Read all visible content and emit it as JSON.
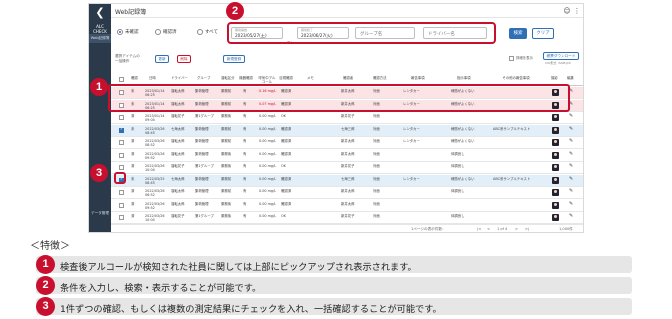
{
  "app": {
    "title": "Web記録簿",
    "brand": "ALC CHECK",
    "nav_item": "Web記録簿",
    "data_admin": "データ管理"
  },
  "filter": {
    "radio_unconfirmed": "未確認",
    "radio_confirmed": "確認済",
    "radio_all": "すべて",
    "start_label": "期間開始",
    "start_value": "2023/05/27(土)",
    "end_label": "期間終了",
    "end_value": "2023/06/27(火)",
    "tilde": "～",
    "group_placeholder": "グループ名",
    "driver_placeholder": "ドライバー名",
    "search_button": "検索",
    "clear_button": "クリア"
  },
  "controls": {
    "selection_note": "選択アイテムの一括操作",
    "update_button": "更新",
    "delete_button": "削除",
    "new_register_button": "新規登録",
    "show_detail_label": "詳細を表示",
    "csv_download_button": "帳票ダウンロード",
    "csv_sub": "CSV形式（Shift-JIS）"
  },
  "table": {
    "columns": [
      "確認",
      "日時",
      "ドライバー",
      "グループ",
      "運転区分",
      "機器確認",
      "呼気中アルコール",
      "目視確認",
      "メモ",
      "確認者",
      "確認方法",
      "報告事項",
      "指示事項",
      "その他の報告事項",
      "撮影",
      "編集"
    ],
    "rows": [
      {
        "status": "未",
        "date": "2023/01/14 06:25",
        "driver": "運転太郎",
        "group": "集荷管理",
        "kind": "乗務前",
        "dev": "有",
        "alc": "0.16 mg/L",
        "visual": "確認済",
        "memo": "",
        "confirmer": "新井太郎",
        "method": "対面",
        "report": "レンタカー",
        "instruct": "様態がよくない",
        "other": "",
        "type": "alert"
      },
      {
        "status": "未",
        "date": "2023/01/14 06:25",
        "driver": "運転太郎",
        "group": "集荷管理",
        "kind": "乗務前",
        "dev": "有",
        "alc": "0.07 mg/L",
        "visual": "確認済",
        "memo": "",
        "confirmer": "新井太郎",
        "method": "対面",
        "report": "レンタカー",
        "instruct": "様態がよくない",
        "other": "",
        "type": "alert"
      },
      {
        "status": "済",
        "date": "2023/01/14 09:04",
        "driver": "運転花子",
        "group": "第1グループ",
        "kind": "乗務後",
        "dev": "有",
        "alc": "0.00 mg/L",
        "visual": "OK",
        "memo": "",
        "confirmer": "新井花子",
        "method": "対面",
        "report": "",
        "instruct": "",
        "other": "",
        "type": "normal"
      },
      {
        "status": "未",
        "date": "2022/03/26 08:45",
        "driver": "七海太郎",
        "group": "集荷管理",
        "kind": "乗務前",
        "dev": "有",
        "alc": "0.00 mg/L",
        "visual": "確認済",
        "memo": "",
        "confirmer": "七海三郎",
        "method": "対面",
        "report": "レンタカー",
        "instruct": "様態がよくない",
        "other": "ABC系サンプルテキスト",
        "type": "sel"
      },
      {
        "status": "済",
        "date": "2022/03/26 08:52",
        "driver": "運転太郎",
        "group": "集荷管理",
        "kind": "乗務前",
        "dev": "有",
        "alc": "0.00 mg/L",
        "visual": "確認済",
        "memo": "",
        "confirmer": "新井太郎",
        "method": "対面",
        "report": "レンタカー",
        "instruct": "様態がよくない",
        "other": "",
        "type": "normal"
      },
      {
        "status": "済",
        "date": "2022/03/26 09:52",
        "driver": "運転太郎",
        "group": "集荷管理",
        "kind": "乗務後",
        "dev": "有",
        "alc": "0.00 mg/L",
        "visual": "確認済",
        "memo": "",
        "confirmer": "新井太郎",
        "method": "対面",
        "report": "",
        "instruct": "体調良し",
        "other": "",
        "type": "normal"
      },
      {
        "status": "済",
        "date": "2022/03/26 10:04",
        "driver": "運転花子",
        "group": "第1グループ",
        "kind": "乗務後",
        "dev": "有",
        "alc": "0.00 mg/L",
        "visual": "OK",
        "memo": "",
        "confirmer": "新井花子",
        "method": "対面",
        "report": "",
        "instruct": "体調良し",
        "other": "",
        "type": "normal"
      },
      {
        "status": "未",
        "date": "2022/03/25 08:45",
        "driver": "七海太郎",
        "group": "集荷管理",
        "kind": "乗務前",
        "dev": "有",
        "alc": "0.00 mg/L",
        "visual": "確認済",
        "memo": "",
        "confirmer": "七海三郎",
        "method": "対面",
        "report": "レンタカー",
        "instruct": "様態がよくない",
        "other": "ABC系サンプルテキスト",
        "type": "sel"
      },
      {
        "status": "済",
        "date": "2022/03/26 06:52",
        "driver": "運転太郎",
        "group": "集荷管理",
        "kind": "乗務前",
        "dev": "有",
        "alc": "0.00 mg/L",
        "visual": "確認済",
        "memo": "",
        "confirmer": "新井太郎",
        "method": "対面",
        "report": "",
        "instruct": "体調良し",
        "other": "",
        "type": "normal"
      },
      {
        "status": "済",
        "date": "2022/03/26 09:52",
        "driver": "運転太郎",
        "group": "集荷管理",
        "kind": "乗務後",
        "dev": "有",
        "alc": "0.00 mg/L",
        "visual": "確認済",
        "memo": "",
        "confirmer": "新井太郎",
        "method": "対面",
        "report": "",
        "instruct": "",
        "other": "",
        "type": "normal"
      },
      {
        "status": "済",
        "date": "2022/03/26 10:04",
        "driver": "運転花子",
        "group": "第1グループ",
        "kind": "乗務後",
        "dev": "有",
        "alc": "0.00 mg/L",
        "visual": "OK",
        "memo": "",
        "confirmer": "新井花子",
        "method": "対面",
        "report": "",
        "instruct": "体調良し",
        "other": "",
        "type": "normal"
      }
    ],
    "pager_rows": "1ページの表示件数：",
    "pager_page": "1 of 4",
    "pager_total": "1,000件"
  },
  "badges": {
    "one": "1",
    "two": "2",
    "three": "3"
  },
  "features": {
    "title": "＜特徴＞",
    "items": [
      {
        "num": "1",
        "text": "検査後アルコールが検知された社員に関しては上部にピックアップされ表示されます。"
      },
      {
        "num": "2",
        "text": "条件を入力し、検索・表示することが可能です。"
      },
      {
        "num": "3",
        "text": "1件ずつの確認、もしくは複数の測定結果にチェックを入れ、一括確認することが可能です。"
      }
    ]
  },
  "colors": {
    "accent": "#c8102e",
    "primary": "#2f6fb6",
    "sidebar": "#2b3a4a",
    "alert_row": "#fbe3e6",
    "selected_row": "#e2eef8"
  }
}
